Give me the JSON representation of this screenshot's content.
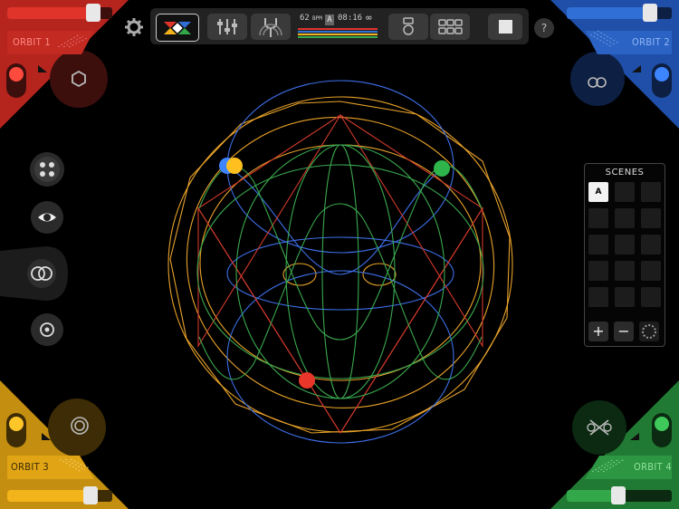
{
  "orbits": [
    {
      "label": "ORBIT 1",
      "color": "#e0342b",
      "dark": "#a5211c",
      "level": 0.82
    },
    {
      "label": "ORBIT 2",
      "color": "#2f6fd6",
      "dark": "#1d4fa6",
      "level": 0.79
    },
    {
      "label": "ORBIT 3",
      "color": "#f3b31b",
      "dark": "#c48e10",
      "level": 0.79
    },
    {
      "label": "ORBIT 4",
      "color": "#33a84a",
      "dark": "#217a33",
      "level": 0.49
    }
  ],
  "toolbar": {
    "tempo_value": "62",
    "tempo_unit": "BPM",
    "scene_letter": "A",
    "time": "08:16",
    "loop_symbol": "∞"
  },
  "help_label": "?",
  "scenes": {
    "title": "SCENES",
    "active_label": "A",
    "add_label": "+",
    "remove_label": "−"
  },
  "icons": {
    "settings": "gear-icon",
    "palette": "color-palette-icon",
    "mixer": "mixer-sliders-icon",
    "tuning": "tuning-fork-icon",
    "instrument": "instrument-icon",
    "grid": "grid-layout-icon",
    "stop": "stop-icon",
    "help": "help-icon"
  }
}
